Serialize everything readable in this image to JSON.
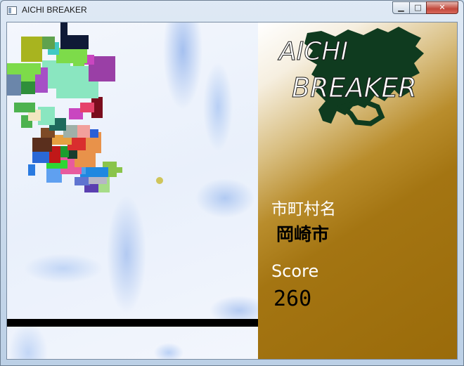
{
  "window": {
    "title": "AICHI BREAKER",
    "icon": "app-icon",
    "buttons": [
      "minimize-icon",
      "maximize-icon",
      "close-icon"
    ]
  },
  "sidebar": {
    "logo_line1": "AICHI",
    "logo_line2": "BREAKER",
    "municipality_label": "市町村名",
    "municipality_value": "岡崎市",
    "score_label": "Score",
    "score_value": "260"
  },
  "colors": {
    "paddle": "#000000",
    "ball": "#cfc55a",
    "logo_map": "#0f3b1f"
  }
}
